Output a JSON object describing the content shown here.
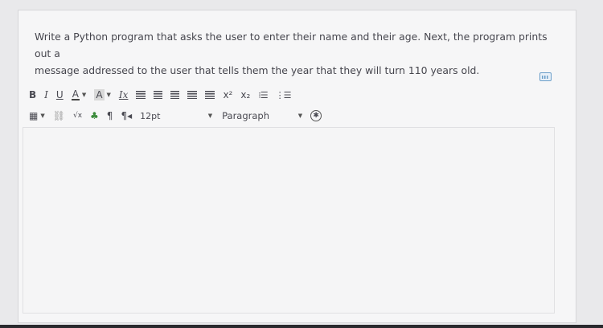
{
  "question": {
    "line1": "Write a Python program that asks the user to enter their name and their age. Next, the program prints out a",
    "line2": "message addressed to the user that tells them the year that they will turn 110 years old."
  },
  "toolbar": {
    "bold": "B",
    "italic": "I",
    "underline": "U",
    "font_color": "A",
    "highlight_color": "A",
    "clear_format": "Ix",
    "superscript": "x²",
    "subscript": "x₂",
    "font_size": "12pt",
    "paragraph_format": "Paragraph",
    "table_icon": "table-icon",
    "unlink_icon": "unlink-icon",
    "math_icon": "√x",
    "accessibility_icon": "accessibility-icon"
  },
  "editor": {
    "value": ""
  },
  "colors": {
    "card_bg": "#f6f6f7",
    "page_bg": "#e9e9eb",
    "text": "#46464e"
  }
}
